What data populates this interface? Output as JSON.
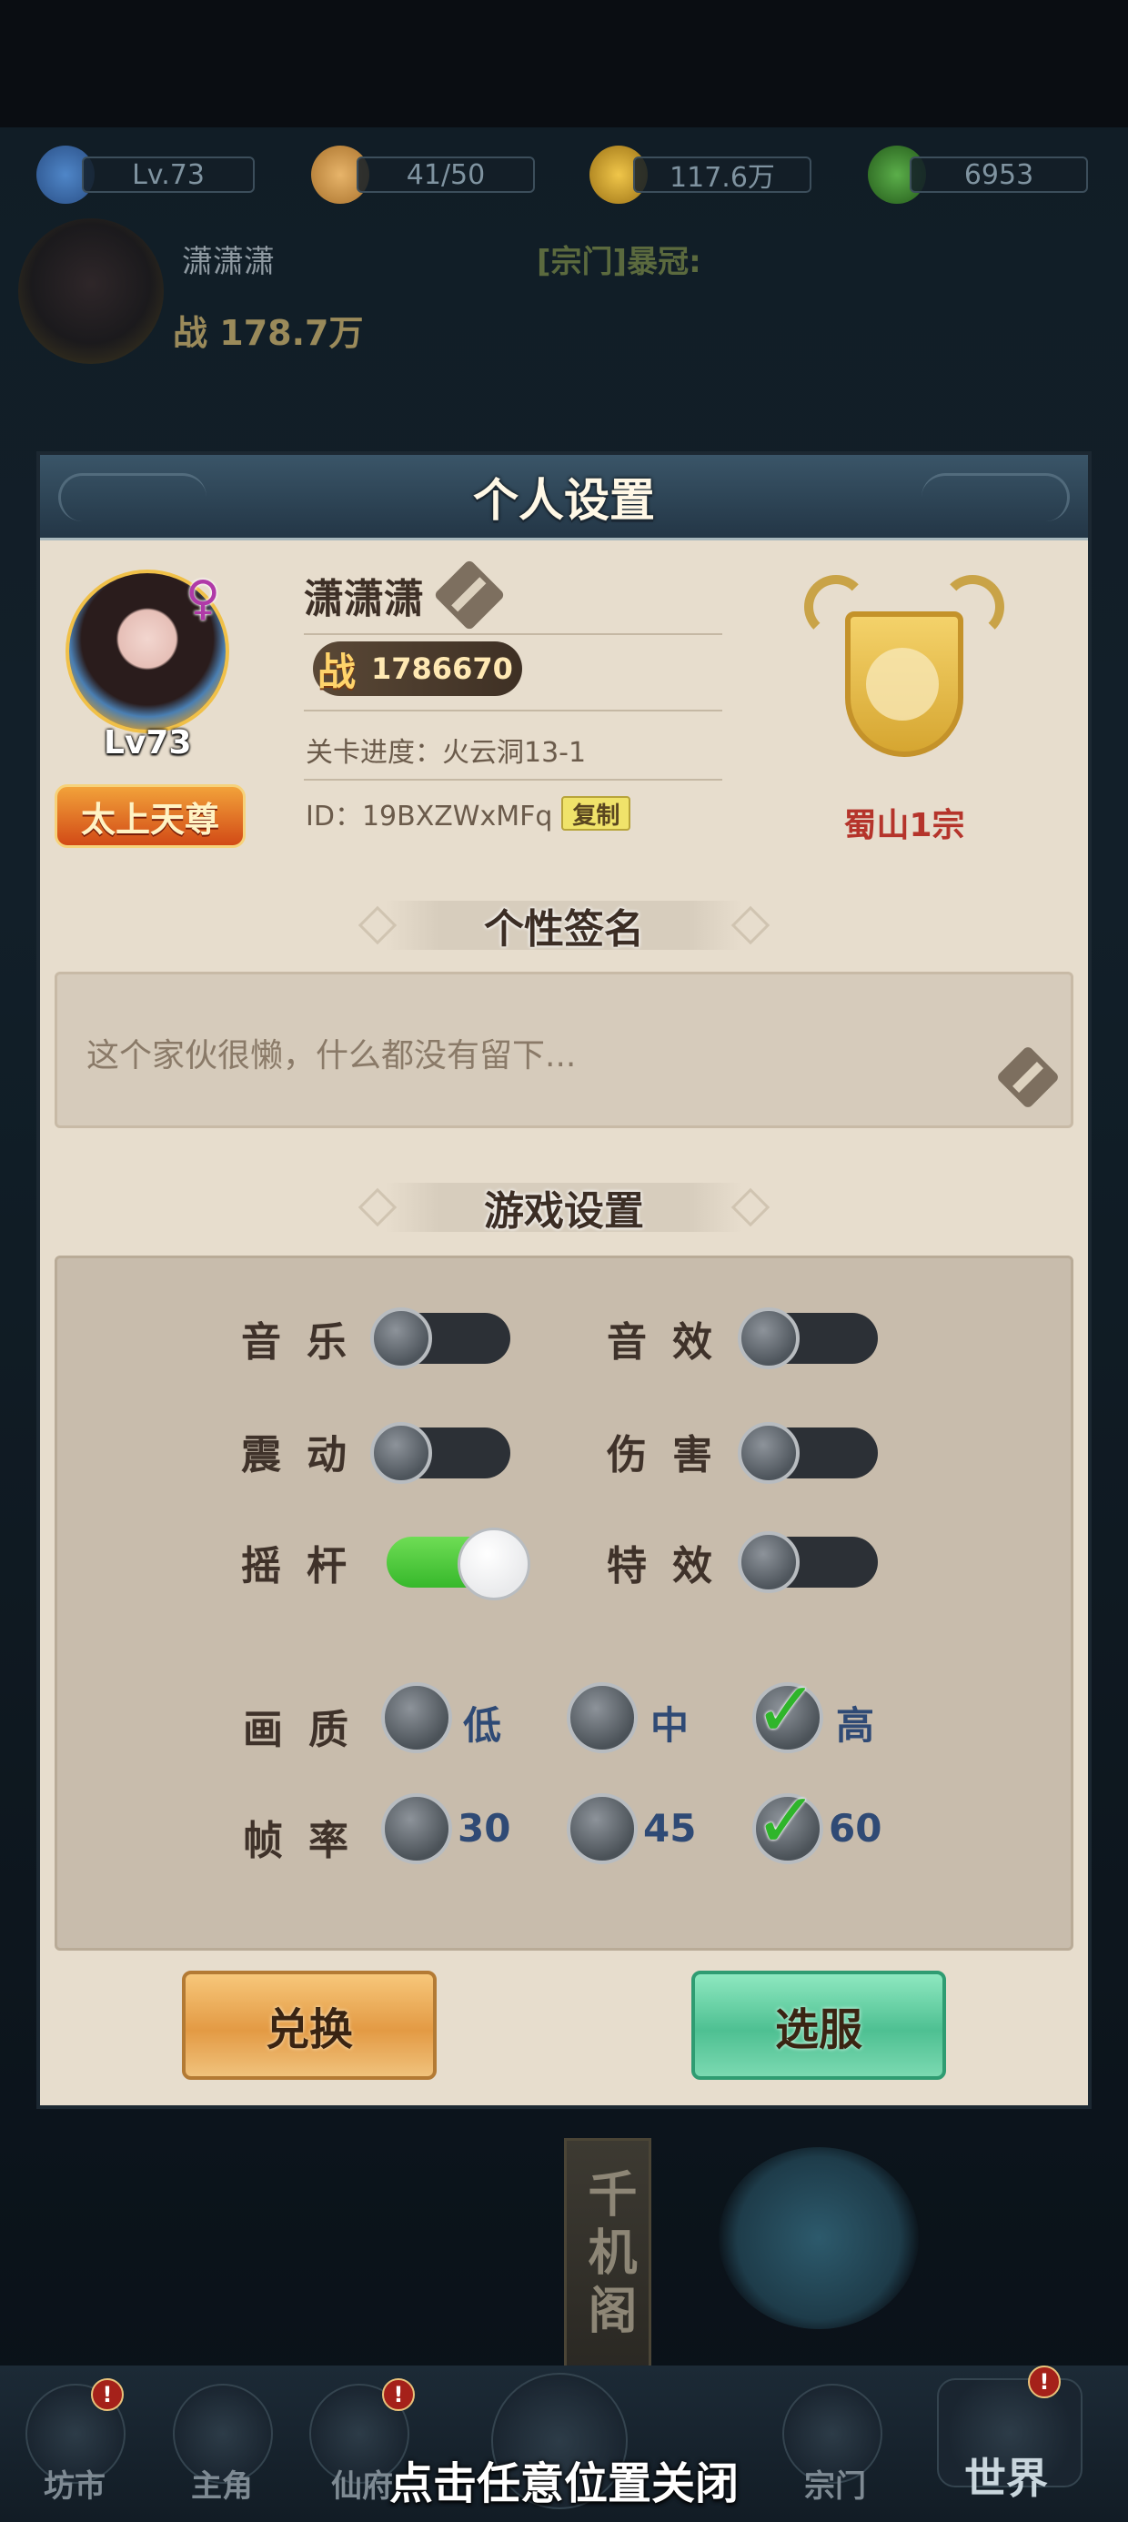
{
  "hud": {
    "level": "Lv.73",
    "stamina": "41/50",
    "coins": "117.6万",
    "jade": "6953",
    "player_name": "潇潇潇",
    "power_label": "战",
    "power_value": "178.7万",
    "sect_broadcast": "[宗门]暴冠:"
  },
  "dialog": {
    "title": "个人设置",
    "profile": {
      "name": "潇潇潇",
      "level": "Lv73",
      "rank": "太上天尊",
      "power_label": "战",
      "power": "1786670",
      "progress": "关卡进度：火云洞13-1",
      "id": "ID：19BXZWxMFq",
      "copy": "复制",
      "sect": "蜀山1宗",
      "gender": "♀"
    },
    "signature": {
      "heading": "个性签名",
      "text": "这个家伙很懒，什么都没有留下..."
    },
    "game_settings": {
      "heading": "游戏设置",
      "toggles": [
        {
          "label": "音乐",
          "on": false
        },
        {
          "label": "音效",
          "on": false
        },
        {
          "label": "震动",
          "on": false
        },
        {
          "label": "伤害",
          "on": false
        },
        {
          "label": "摇杆",
          "on": true
        },
        {
          "label": "特效",
          "on": false
        }
      ],
      "quality": {
        "label": "画质",
        "options": [
          "低",
          "中",
          "高"
        ],
        "selected": "高"
      },
      "framerate": {
        "label": "帧率",
        "options": [
          "30",
          "45",
          "60"
        ],
        "selected": "60"
      }
    },
    "buttons": {
      "exchange": "兑换",
      "select_server": "选服"
    }
  },
  "bottom_nav": {
    "items": [
      "坊市",
      "主角",
      "仙府",
      "宗门",
      "世界"
    ],
    "scroll_text": "千机阁",
    "close_hint": "点击任意位置关闭"
  },
  "colors": {
    "toggle_on": "#37b82b",
    "toggle_off": "#2c3036",
    "dialog_bg": "#e7ddcd",
    "sect_name": "#b5342b",
    "radio_text": "#2f4a75"
  }
}
